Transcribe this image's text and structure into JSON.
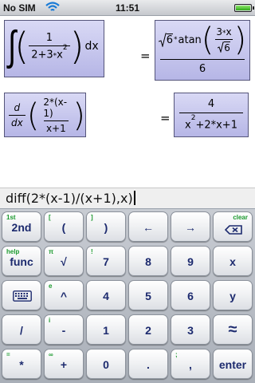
{
  "status_bar": {
    "carrier": "No SIM",
    "time": "11:51",
    "wifi_icon": "wifi-icon",
    "battery_icon": "battery-icon"
  },
  "history": [
    {
      "input": {
        "operator": "∫",
        "numerator": "1",
        "denominator_a": "2+3",
        "denominator_x": "x",
        "denominator_exp": "2",
        "star": "*",
        "dx": "dx"
      },
      "equals": "=",
      "result": {
        "sqrt_arg": "6",
        "star1": "*",
        "func": "atan",
        "inner_num": "3",
        "inner_star": "*",
        "inner_x": "x",
        "inner_sqrt_arg": "6",
        "denominator": "6"
      }
    },
    {
      "input": {
        "d_num": "d",
        "d_den": "dx",
        "numerator": "2*(x-1)",
        "denominator": "x+1"
      },
      "equals": "=",
      "result": {
        "numerator": "4",
        "den_x1": "x",
        "den_exp": "2",
        "den_rest": "+2*x+1"
      }
    }
  ],
  "input_line": {
    "text": "diff(2*(x-1)/(x+1),x)"
  },
  "keypad": {
    "rows": [
      [
        {
          "main": "2nd",
          "sub": "1st"
        },
        {
          "main": "(",
          "sub": "["
        },
        {
          "main": ")",
          "sub": "]"
        },
        {
          "main": "←",
          "sub": ""
        },
        {
          "main": "→",
          "sub": ""
        },
        {
          "main": "",
          "sub": "clear",
          "icon": "backspace-icon"
        }
      ],
      [
        {
          "main": "func",
          "sub": "help"
        },
        {
          "main": "√",
          "sub": "π"
        },
        {
          "main": "7",
          "sub": "!"
        },
        {
          "main": "8",
          "sub": ""
        },
        {
          "main": "9",
          "sub": ""
        },
        {
          "main": "x",
          "sub": ""
        }
      ],
      [
        {
          "main": "",
          "sub": "",
          "icon": "keyboard-icon"
        },
        {
          "main": "^",
          "sub": "e"
        },
        {
          "main": "4",
          "sub": ""
        },
        {
          "main": "5",
          "sub": ""
        },
        {
          "main": "6",
          "sub": ""
        },
        {
          "main": "y",
          "sub": ""
        }
      ],
      [
        {
          "main": "/",
          "sub": ""
        },
        {
          "main": "-",
          "sub": "i"
        },
        {
          "main": "1",
          "sub": ""
        },
        {
          "main": "2",
          "sub": ""
        },
        {
          "main": "3",
          "sub": ""
        },
        {
          "main": "≈",
          "sub": ""
        }
      ],
      [
        {
          "main": "*",
          "sub": "="
        },
        {
          "main": "+",
          "sub": "∞"
        },
        {
          "main": "0",
          "sub": ""
        },
        {
          "main": ".",
          "sub": ""
        },
        {
          "main": ",",
          "sub": ";"
        },
        {
          "main": "enter",
          "sub": ""
        }
      ]
    ]
  },
  "colors": {
    "key_text": "#1c2a6e",
    "key_sub": "#1c9a2e",
    "expr_bg": "#c6c6ee"
  }
}
